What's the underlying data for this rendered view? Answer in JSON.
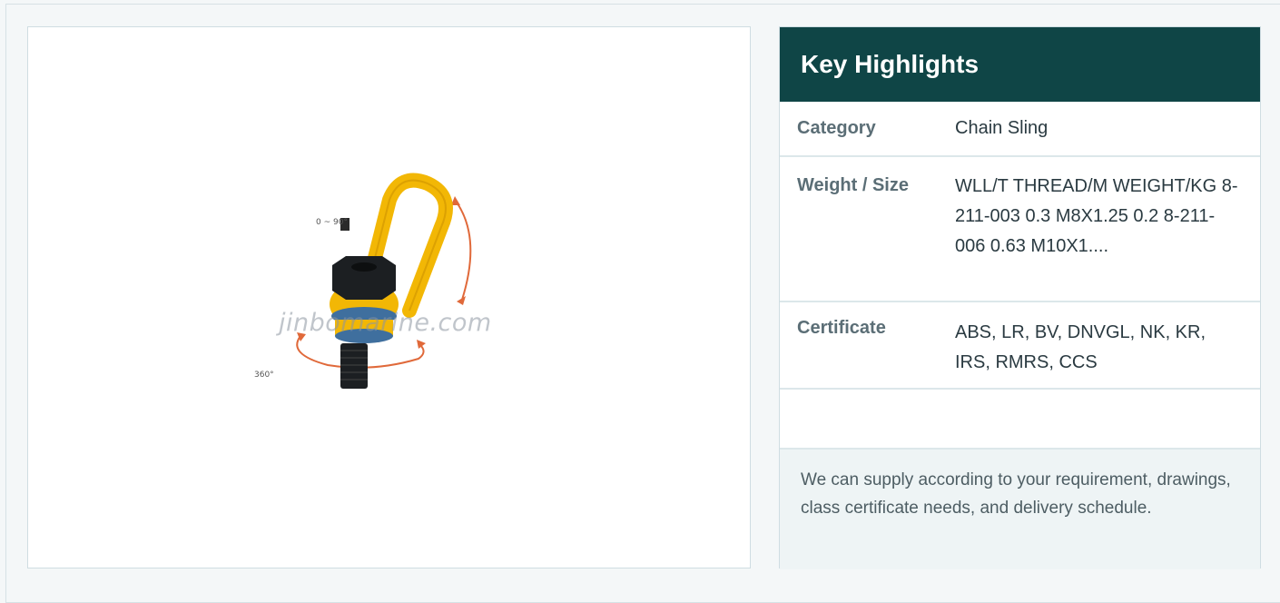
{
  "image": {
    "watermark": "jinbomarine.com",
    "angle_label": "0 ~ 90°",
    "rotation_label": "360°",
    "colors": {
      "eye": "#f2b705",
      "nut": "#1c1f22",
      "arrow": "#e0693a",
      "washer": "#3f6f9e"
    }
  },
  "panel": {
    "title": "Key Highlights",
    "rows": [
      {
        "key": "Category",
        "value": "Chain Sling"
      },
      {
        "key": "Weight / Size",
        "value": "WLL/T THREAD/M WEIGHT/KG 8-211-003 0.3 M8X1.25 0.2 8-211-006 0.63 M10X1...."
      },
      {
        "key": "Certificate",
        "value": "ABS, LR, BV, DNVGL, NK, KR, IRS, RMRS, CCS"
      }
    ],
    "note": "We can supply according to your requirement, drawings, class certificate needs, and delivery schedule.",
    "colors": {
      "header_bg": "#0f4546",
      "note_bg": "#eef4f5"
    }
  }
}
